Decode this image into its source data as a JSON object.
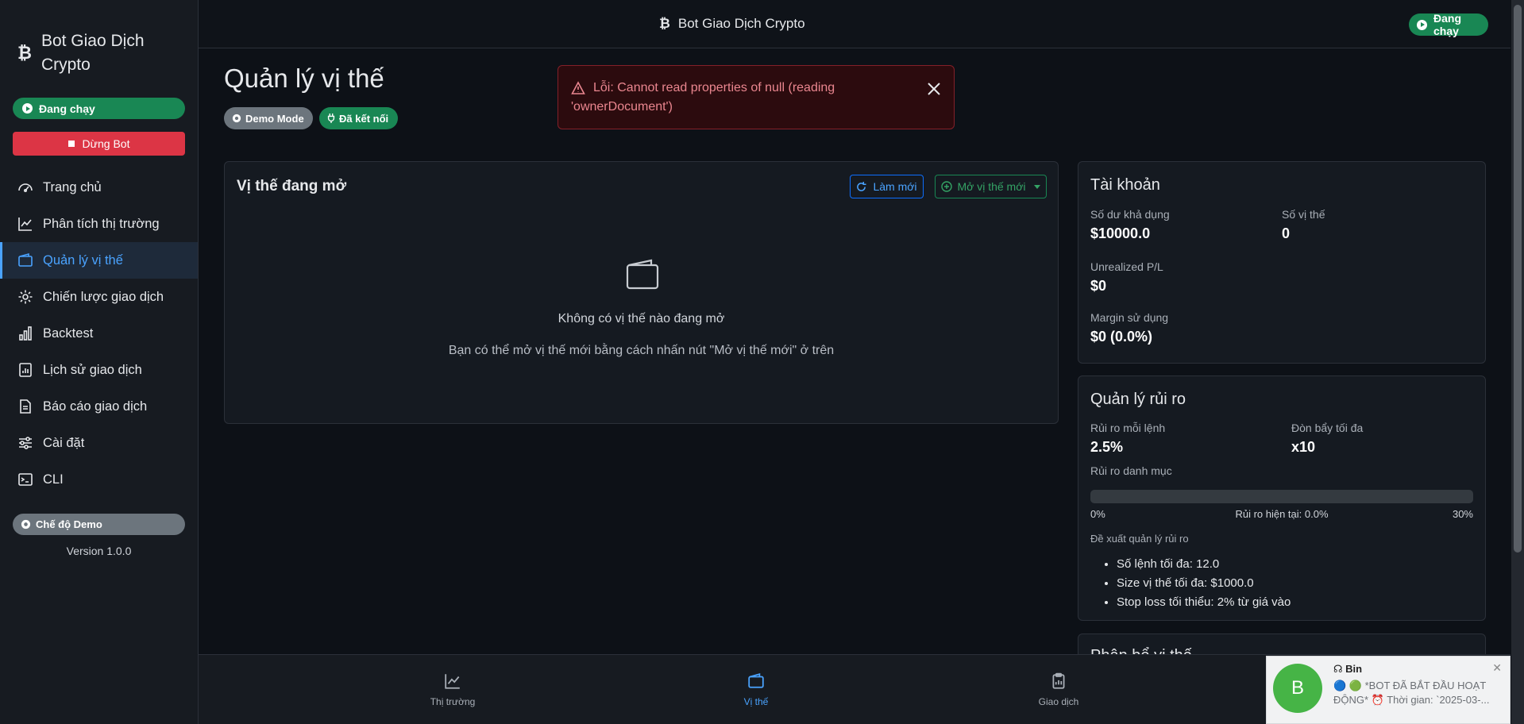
{
  "app": {
    "brand_name": "Bot Giao Dịch Crypto",
    "status_running": "Đang chạy",
    "stop_button": "Dừng Bot",
    "demo_mode_pill": "Chế độ Demo",
    "version": "Version 1.0.0"
  },
  "sidebar": {
    "items": [
      {
        "label": "Trang chủ",
        "icon": "speedometer-icon"
      },
      {
        "label": "Phân tích thị trường",
        "icon": "chart-line-icon"
      },
      {
        "label": "Quản lý vị thế",
        "icon": "wallet-icon"
      },
      {
        "label": "Chiến lược giao dịch",
        "icon": "gear-icon"
      },
      {
        "label": "Backtest",
        "icon": "bar-chart-icon"
      },
      {
        "label": "Lịch sử giao dịch",
        "icon": "history-icon"
      },
      {
        "label": "Báo cáo giao dịch",
        "icon": "report-icon"
      },
      {
        "label": "Cài đặt",
        "icon": "sliders-icon"
      },
      {
        "label": "CLI",
        "icon": "terminal-icon"
      }
    ],
    "active_index": 2
  },
  "topbar": {
    "title": "Bot Giao Dịch Crypto",
    "status": "Đang chạy"
  },
  "page": {
    "title": "Quản lý vị thế",
    "badge_demo": "Demo Mode",
    "badge_connected": "Đã kết nối"
  },
  "alert": {
    "message_line1": "Lỗi: Cannot read properties of null (reading",
    "message_line2": "'ownerDocument')"
  },
  "open_positions": {
    "title": "Vị thế đang mở",
    "refresh_button": "Làm mới",
    "open_button": "Mở vị thế mới",
    "empty_title": "Không có vị thế nào đang mở",
    "empty_hint": "Bạn có thể mở vị thế mới bằng cách nhấn nút \"Mở vị thế mới\" ở trên"
  },
  "account": {
    "title": "Tài khoản",
    "available_balance_label": "Số dư khả dụng",
    "available_balance": "$10000.0",
    "positions_count_label": "Số vị thế",
    "positions_count": "0",
    "unrealized_label": "Unrealized P/L",
    "unrealized": "$0",
    "margin_label": "Margin sử dụng",
    "margin": "$0 (0.0%)"
  },
  "risk": {
    "title": "Quản lý rủi ro",
    "per_order_label": "Rủi ro mỗi lệnh",
    "per_order": "2.5%",
    "max_leverage_label": "Đòn bẩy tối đa",
    "max_leverage": "x10",
    "portfolio_label": "Rủi ro danh mục",
    "portfolio_current_fraction": 0.0,
    "scale_min": "0%",
    "scale_current": "Rủi ro hiện tại: 0.0%",
    "scale_max": "30%",
    "recommend_label": "Đề xuất quản lý rủi ro",
    "recommendations": [
      "Số lệnh tối đa: 12.0",
      "Size vị thế tối đa: $1000.0",
      "Stop loss tối thiểu: 2% từ giá vào"
    ]
  },
  "position_allocation": {
    "title": "Phân bổ vị thế"
  },
  "bottom_nav": [
    {
      "label": "Thị trường",
      "icon": "chart-line-icon"
    },
    {
      "label": "Vị thế",
      "icon": "wallet-icon"
    },
    {
      "label": "Giao dịch",
      "icon": "clipboard-icon"
    }
  ],
  "toast": {
    "avatar_letter": "B",
    "sender": "Bin",
    "text": "🔵 🟢 *BOT ĐÃ BẮT ĐẦU HOẠT ĐỘNG* ⏰ Thời gian: `2025-03-..."
  },
  "colors": {
    "accent": "#4aa3ff",
    "success": "#198754",
    "danger": "#dc3545",
    "secondary": "#6c757d",
    "background": "#0d1117"
  }
}
